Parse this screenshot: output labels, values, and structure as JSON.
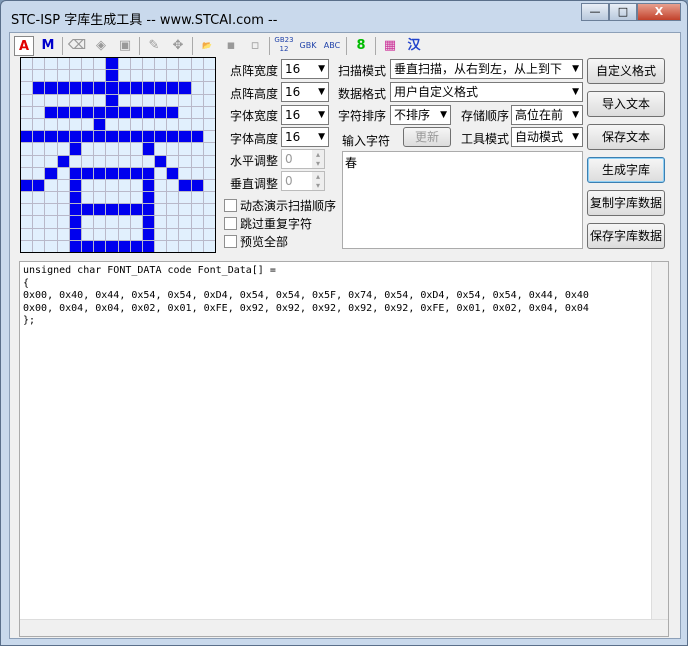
{
  "window": {
    "title": "STC-ISP 字库生成工具 -- www.STCAI.com --",
    "min": "—",
    "max": "□",
    "close": "X"
  },
  "toolbar": {
    "items": [
      {
        "name": "font-a-icon",
        "label": "A",
        "color": "#e00000"
      },
      {
        "name": "font-m-icon",
        "label": "M",
        "color": "#0000cc"
      },
      {
        "name": "eraser-icon",
        "label": "⌫",
        "color": "#999"
      },
      {
        "name": "fill-icon",
        "label": "◈",
        "color": "#999"
      },
      {
        "name": "stamp-icon",
        "label": "▣",
        "color": "#999"
      },
      {
        "name": "pencil-icon",
        "label": "✎",
        "color": "#999"
      },
      {
        "name": "move-icon",
        "label": "✥",
        "color": "#999"
      },
      {
        "name": "open-icon",
        "label": "📂",
        "color": "#999"
      },
      {
        "name": "save-icon",
        "label": "▪",
        "color": "#999"
      },
      {
        "name": "save-as-icon",
        "label": "▫",
        "color": "#999"
      },
      {
        "name": "gb2312-icon",
        "label": "GB2312",
        "color": "#2244aa"
      },
      {
        "name": "gbk-icon",
        "label": "GBK",
        "color": "#2244aa"
      },
      {
        "name": "abc-icon",
        "label": "ABC",
        "color": "#2244aa"
      },
      {
        "name": "seven-seg-icon",
        "label": "8",
        "color": "#00bb00"
      },
      {
        "name": "color-palette-icon",
        "label": "▦",
        "color": "#cc3399"
      },
      {
        "name": "chinese-icon",
        "label": "汉",
        "color": "#2244cc"
      }
    ]
  },
  "bitmap": [
    "0000000100000000",
    "0000000100000000",
    "0111111111111100",
    "0000000100000000",
    "0011111111111000",
    "0000001000000000",
    "1111111111111110",
    "0000100000100000",
    "0001000000010000",
    "0010111111101000",
    "1100100000100110",
    "0000100000100000",
    "0000111111100000",
    "0000100000100000",
    "0000100000100000",
    "0000111111100000"
  ],
  "settings": {
    "dot_width": {
      "label": "点阵宽度",
      "value": "16"
    },
    "dot_height": {
      "label": "点阵高度",
      "value": "16"
    },
    "font_width": {
      "label": "字体宽度",
      "value": "16"
    },
    "font_height": {
      "label": "字体高度",
      "value": "16"
    },
    "h_adjust": {
      "label": "水平调整",
      "value": "0"
    },
    "v_adjust": {
      "label": "垂直调整",
      "value": "0"
    },
    "scan_mode": {
      "label": "扫描模式",
      "value": "垂直扫描，从右到左，从上到下"
    },
    "data_format": {
      "label": "数据格式",
      "value": "用户自定义格式"
    },
    "char_order": {
      "label": "字符排序",
      "value": "不排序"
    },
    "store_order": {
      "label": "存储顺序",
      "value": "高位在前"
    },
    "tool_mode": {
      "label": "工具模式",
      "value": "自动模式"
    },
    "input_label": "输入字符",
    "update": "更新"
  },
  "checks": [
    "动态演示扫描顺序",
    "跳过重复字符",
    "预览全部"
  ],
  "buttons": {
    "custom_format": "自定义格式",
    "import_text": "导入文本",
    "save_text": "保存文本",
    "generate": "生成字库",
    "copy": "复制字库数据",
    "save_data": "保存字库数据"
  },
  "input_text": "春",
  "output": "unsigned char FONT_DATA code Font_Data[] =\n{\n0x00, 0x40, 0x44, 0x54, 0x54, 0xD4, 0x54, 0x54, 0x5F, 0x74, 0x54, 0xD4, 0x54, 0x54, 0x44, 0x40\n0x00, 0x04, 0x04, 0x02, 0x01, 0xFE, 0x92, 0x92, 0x92, 0x92, 0x92, 0xFE, 0x01, 0x02, 0x04, 0x04\n};"
}
